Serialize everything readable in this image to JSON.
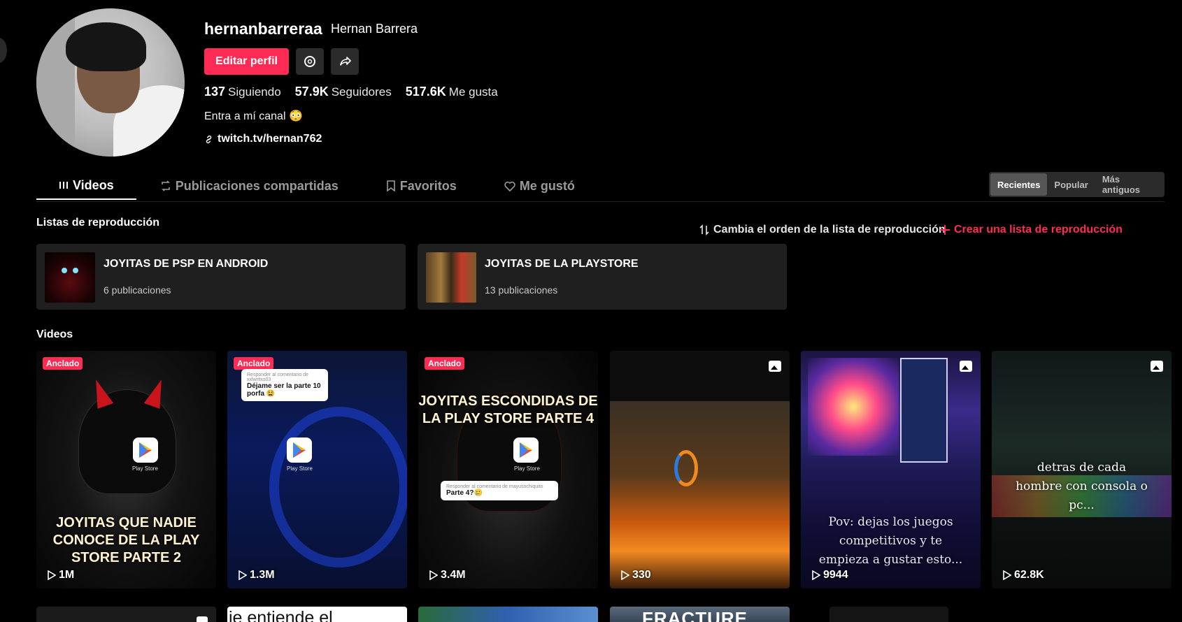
{
  "profile": {
    "username": "hernanbarreraa",
    "display_name": "Hernan Barrera",
    "edit_profile_label": "Editar perfil",
    "stats": {
      "following_count": "137",
      "following_label": "Siguiendo",
      "followers_count": "57.9K",
      "followers_label": "Seguidores",
      "likes_count": "517.6K",
      "likes_label": "Me gusta"
    },
    "bio": "Entra a mí canal 😳",
    "link": "twitch.tv/hernan762"
  },
  "tabs": [
    {
      "label": "Videos",
      "icon": "grid-icon",
      "active": true
    },
    {
      "label": "Publicaciones compartidas",
      "icon": "repost-icon"
    },
    {
      "label": "Favoritos",
      "icon": "bookmark-icon"
    },
    {
      "label": "Me gustó",
      "icon": "heart-icon"
    }
  ],
  "sort": {
    "options": [
      "Recientes",
      "Popular",
      "Más antiguos"
    ],
    "selected": "Recientes"
  },
  "playlists_section": {
    "title": "Listas de reproducción",
    "reorder_label": "Cambia el orden de la lista de reproducción",
    "create_label": "Crear una lista de reproducción",
    "items": [
      {
        "name": "JOYITAS DE PSP EN ANDROID",
        "count": "6 publicaciones"
      },
      {
        "name": "JOYITAS DE LA PLAYSTORE",
        "count": "13 publicaciones"
      }
    ]
  },
  "videos_section": {
    "title": "Videos",
    "pinned_label": "Anclado",
    "playstore_label": "Play Store",
    "items": [
      {
        "views": "1M",
        "caption": "JOYITAS QUE NADIE CONOCE DE LA PLAY STORE PARTE 2"
      },
      {
        "views": "1.3M",
        "comment_header": "Responder al comentario de xxlwritxs03",
        "comment": "Déjame ser la parte 10 porfa 😫"
      },
      {
        "views": "3.4M",
        "caption": "JOYITAS ESCONDIDAS DE LA PLAY STORE PARTE 4",
        "comment_header": "Responder al comentario de mayusochiquito",
        "comment": "Parte 4?🥲"
      },
      {
        "views": "330"
      },
      {
        "views": "9944",
        "caption": "Pov: dejas los juegos competitivos y te empieza a gustar esto..."
      },
      {
        "views": "62.8K",
        "caption": "detras de cada hombre con consola o pc..."
      }
    ],
    "second_row_partial": [
      {
        "caption": "ie entiende el"
      },
      {
        "caption": "FRACTURE"
      }
    ]
  },
  "colors": {
    "accent": "#fe2c55",
    "background": "#000000",
    "card": "#1f1f1f"
  }
}
